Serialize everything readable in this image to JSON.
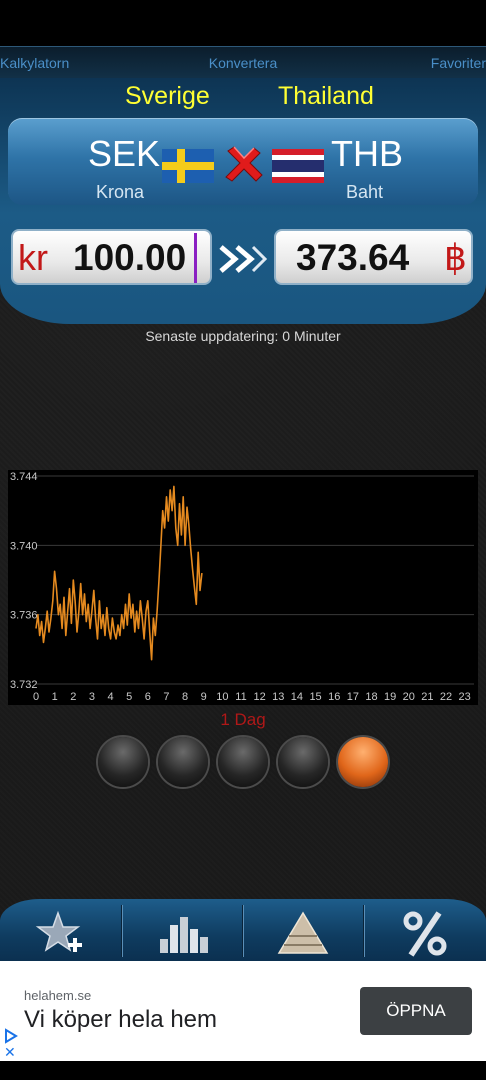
{
  "tabs": {
    "left": "Kalkylatorn",
    "center": "Konvertera",
    "right": "Favoriter"
  },
  "from": {
    "country": "Sverige",
    "code": "SEK",
    "name": "Krona",
    "symbol": "kr",
    "amount": "100.00",
    "flag_icon": "sweden-flag-icon"
  },
  "to": {
    "country": "Thailand",
    "code": "THB",
    "name": "Baht",
    "symbol": "฿",
    "amount": "373.64",
    "flag_icon": "thailand-flag-icon"
  },
  "update_text": "Senaste uppdatering: 0 Minuter",
  "period_label": "1 Dag",
  "period_selected_index": 4,
  "colors": {
    "accent_yellow": "#ffff33",
    "symbol_red": "#c21818",
    "line_orange": "#e58a1f",
    "panel_blue": "#1c5b86"
  },
  "chart_data": {
    "type": "line",
    "x_tick_labels": [
      "0",
      "1",
      "2",
      "3",
      "4",
      "5",
      "6",
      "7",
      "8",
      "9",
      "10",
      "11",
      "12",
      "13",
      "14",
      "15",
      "16",
      "17",
      "18",
      "19",
      "20",
      "21",
      "22",
      "23"
    ],
    "y_tick_labels": [
      "3.744",
      "3.740",
      "3.736",
      "3.732"
    ],
    "ylim": [
      3.732,
      3.744
    ],
    "xlim": [
      0,
      23.5
    ],
    "grid": true,
    "series": [
      {
        "x": [
          0,
          0.1,
          0.2,
          0.3,
          0.4,
          0.5,
          0.6,
          0.7,
          0.8,
          0.9,
          1.0,
          1.1,
          1.2,
          1.3,
          1.4,
          1.5,
          1.6,
          1.7,
          1.8,
          1.9,
          2.0,
          2.1,
          2.2,
          2.3,
          2.4,
          2.5,
          2.6,
          2.7,
          2.8,
          2.9,
          3.0,
          3.1,
          3.2,
          3.3,
          3.4,
          3.5,
          3.6,
          3.7,
          3.8,
          3.9,
          4.0,
          4.1,
          4.2,
          4.3,
          4.4,
          4.5,
          4.6,
          4.7,
          4.8,
          4.9,
          5.0,
          5.1,
          5.2,
          5.3,
          5.4,
          5.5,
          5.6,
          5.7,
          5.8,
          5.9,
          6.0,
          6.1,
          6.2,
          6.3,
          6.4,
          6.5,
          6.6,
          6.7,
          6.8,
          6.9,
          7.0,
          7.1,
          7.2,
          7.3,
          7.4,
          7.5,
          7.6,
          7.7,
          7.8,
          7.9,
          8.0,
          8.1,
          8.2,
          8.3,
          8.4,
          8.5,
          8.6,
          8.7,
          8.8,
          8.9
        ],
        "y": [
          3.7352,
          3.736,
          3.7348,
          3.7356,
          3.7344,
          3.7352,
          3.7362,
          3.735,
          3.7358,
          3.7368,
          3.7385,
          3.7375,
          3.736,
          3.7366,
          3.7352,
          3.737,
          3.7348,
          3.7362,
          3.7375,
          3.7355,
          3.738,
          3.7368,
          3.735,
          3.7362,
          3.7378,
          3.736,
          3.7372,
          3.7356,
          3.7366,
          3.7352,
          3.7362,
          3.7374,
          3.7358,
          3.7346,
          3.7368,
          3.7352,
          3.736,
          3.7348,
          3.7364,
          3.7352,
          3.7346,
          3.7358,
          3.735,
          3.7346,
          3.7354,
          3.7348,
          3.736,
          3.7352,
          3.7366,
          3.7354,
          3.7372,
          3.7358,
          3.7366,
          3.735,
          3.7362,
          3.7352,
          3.7368,
          3.7358,
          3.7346,
          3.7362,
          3.7368,
          3.735,
          3.7334,
          3.7358,
          3.7348,
          3.7362,
          3.738,
          3.74,
          3.742,
          3.741,
          3.7428,
          3.7414,
          3.7432,
          3.742,
          3.7434,
          3.741,
          3.74,
          3.7424,
          3.7406,
          3.7428,
          3.74,
          3.7422,
          3.7412,
          3.7398,
          3.7386,
          3.7376,
          3.7366,
          3.7396,
          3.7374,
          3.7384
        ]
      }
    ]
  }
}
